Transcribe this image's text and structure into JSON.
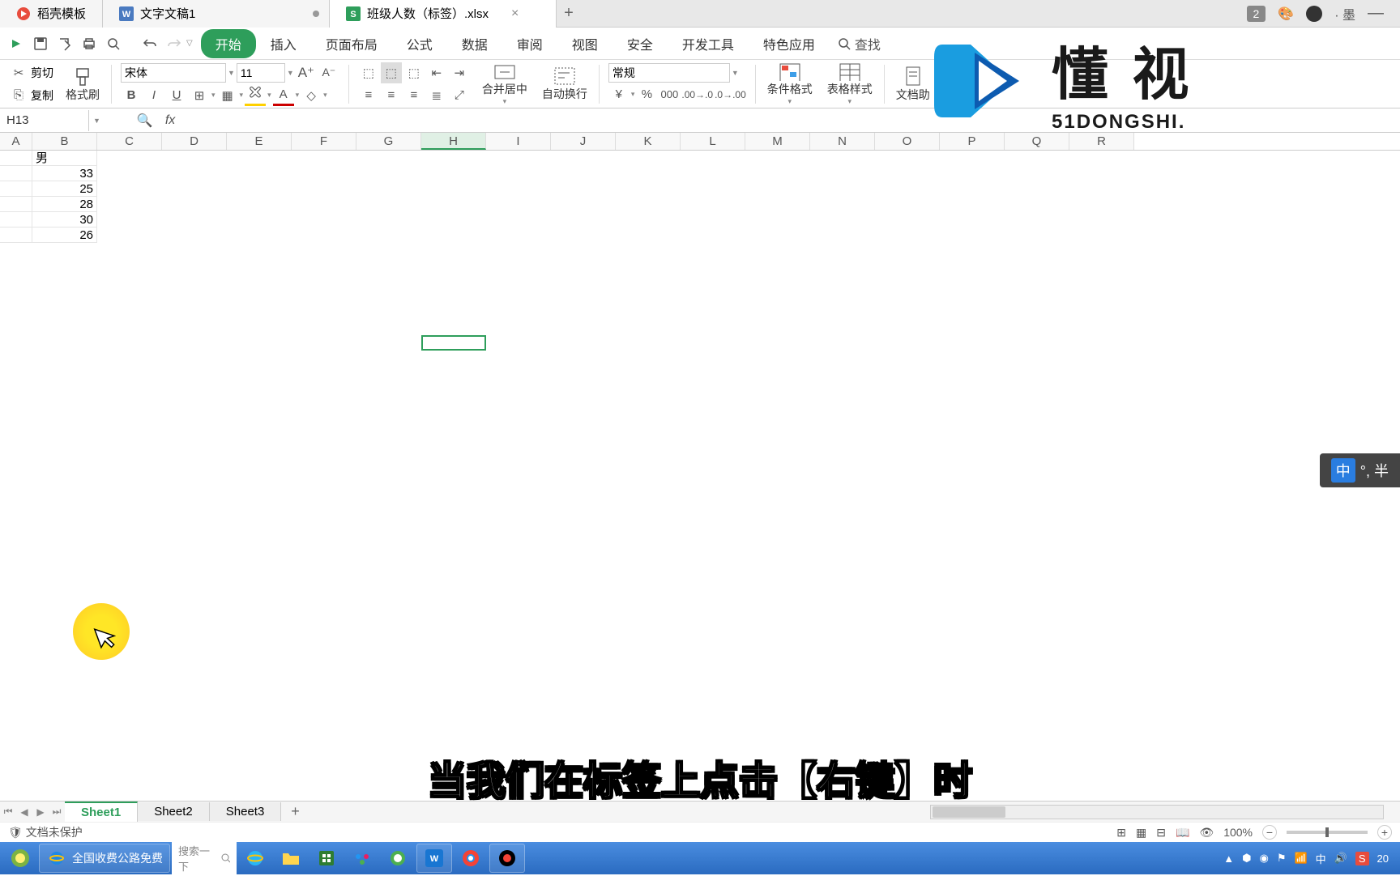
{
  "tabs": {
    "t1": "稻壳模板",
    "t2": "文字文稿1",
    "t3": "班级人数（标签）.xlsx",
    "badge": "2"
  },
  "ribbon_tabs": {
    "start": "开始",
    "insert": "插入",
    "page": "页面布局",
    "formula": "公式",
    "data": "数据",
    "review": "审阅",
    "view": "视图",
    "safe": "安全",
    "dev": "开发工具",
    "special": "特色应用",
    "search": "查找"
  },
  "ribbon": {
    "cut": "剪切",
    "copy": "复制",
    "painter": "格式刷",
    "font_name": "宋体",
    "font_size": "11",
    "merge": "合并居中",
    "wrap": "自动换行",
    "number_fmt": "常规",
    "cond_fmt": "条件格式",
    "table_style": "表格样式",
    "doc_assist": "文档助"
  },
  "cell_ref": "H13",
  "columns": [
    "A",
    "B",
    "C",
    "D",
    "E",
    "F",
    "G",
    "H",
    "I",
    "J",
    "K",
    "L",
    "M",
    "N",
    "O",
    "P",
    "Q",
    "R"
  ],
  "data_rows": {
    "r1_b": "男",
    "r2_b": "33",
    "r3_b": "25",
    "r4_b": "28",
    "r5_b": "30",
    "r6_b": "26"
  },
  "sheets": {
    "s1": "Sheet1",
    "s2": "Sheet2",
    "s3": "Sheet3"
  },
  "status": {
    "protect": "文档未保护",
    "zoom": "100%"
  },
  "taskbar": {
    "browser_task": "全国收费公路免费",
    "search_placeholder": "搜索一下"
  },
  "subtitle": "当我们在标签上点击【右键】时",
  "ime": {
    "cn": "中",
    "rest": "°, 半"
  },
  "watermark": {
    "cn": "懂 视",
    "en": "51DONGSHI."
  }
}
